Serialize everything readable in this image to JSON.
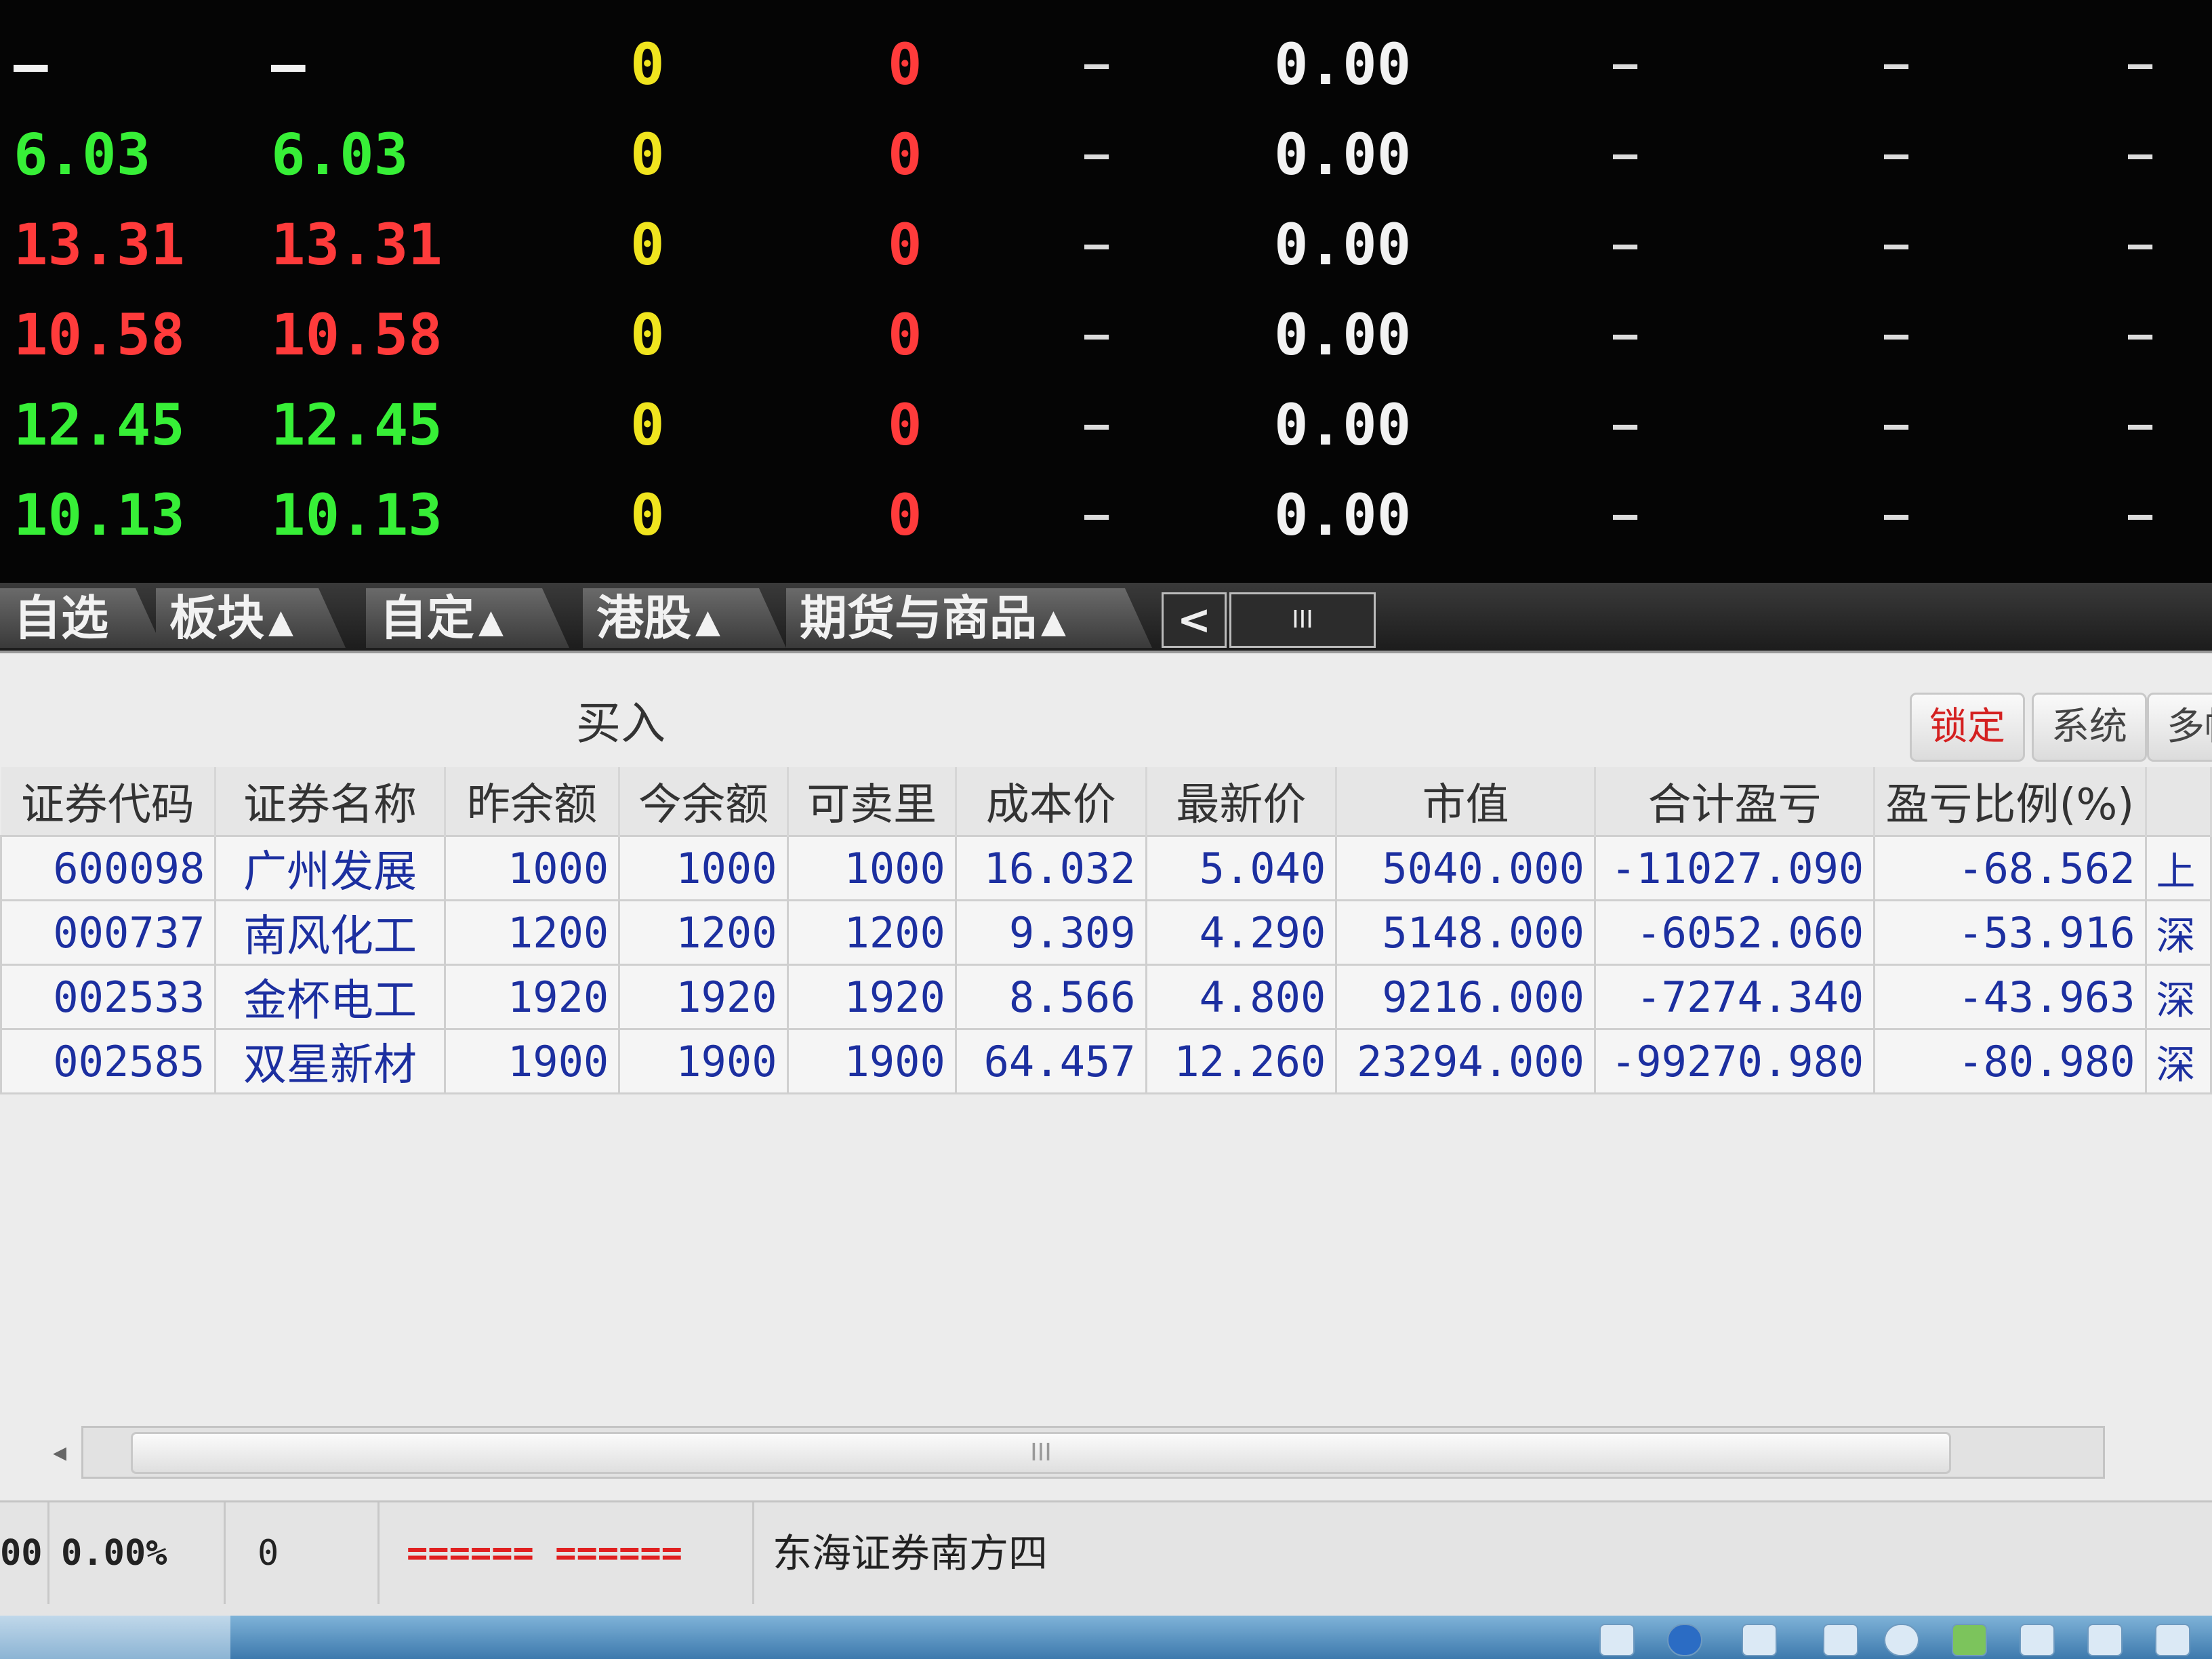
{
  "quote_rows": [
    {
      "c1": "—",
      "c2": "—",
      "c3": "0",
      "c4": "0",
      "c5": "—",
      "c6": "0.00",
      "c7": "—",
      "c8": "—",
      "c9": "—",
      "price_color": "#f2f2f2"
    },
    {
      "c1": "6.03",
      "c2": "6.03",
      "c3": "0",
      "c4": "0",
      "c5": "—",
      "c6": "0.00",
      "c7": "—",
      "c8": "—",
      "c9": "—",
      "price_color": "#37ef37"
    },
    {
      "c1": "13.31",
      "c2": "13.31",
      "c3": "0",
      "c4": "0",
      "c5": "—",
      "c6": "0.00",
      "c7": "—",
      "c8": "—",
      "c9": "—",
      "price_color": "#ff3b3b"
    },
    {
      "c1": "10.58",
      "c2": "10.58",
      "c3": "0",
      "c4": "0",
      "c5": "—",
      "c6": "0.00",
      "c7": "—",
      "c8": "—",
      "c9": "—",
      "price_color": "#ff3b3b"
    },
    {
      "c1": "12.45",
      "c2": "12.45",
      "c3": "0",
      "c4": "0",
      "c5": "—",
      "c6": "0.00",
      "c7": "—",
      "c8": "—",
      "c9": "—",
      "price_color": "#37ef37"
    },
    {
      "c1": "10.13",
      "c2": "10.13",
      "c3": "0",
      "c4": "0",
      "c5": "—",
      "c6": "0.00",
      "c7": "—",
      "c8": "—",
      "c9": "—",
      "price_color": "#37ef37"
    }
  ],
  "tabs": [
    {
      "label": "自选",
      "arrow": ""
    },
    {
      "label": "板块",
      "arrow": "▲"
    },
    {
      "label": "自定",
      "arrow": "▲"
    },
    {
      "label": "港股",
      "arrow": "▲"
    },
    {
      "label": "期货与商品",
      "arrow": "▲"
    }
  ],
  "tab_nav": {
    "left": "<",
    "scroll": "III"
  },
  "panel": {
    "title": "买入",
    "lock_label": "锁定",
    "system_label": "系统",
    "more_label": "多帐"
  },
  "holdings": {
    "columns": [
      "证券代码",
      "证券名称",
      "昨余额",
      "今余额",
      "可卖里",
      "成本价",
      "最新价",
      "市值",
      "合计盈亏",
      "盈亏比例(%)",
      ""
    ],
    "rows": [
      [
        "600098",
        "广州发展",
        "1000",
        "1000",
        "1000",
        "16.032",
        "5.040",
        "5040.000",
        "-11027.090",
        "-68.562",
        "上"
      ],
      [
        "000737",
        "南风化工",
        "1200",
        "1200",
        "1200",
        "9.309",
        "4.290",
        "5148.000",
        "-6052.060",
        "-53.916",
        "深"
      ],
      [
        "002533",
        "金杯电工",
        "1920",
        "1920",
        "1920",
        "8.566",
        "4.800",
        "9216.000",
        "-7274.340",
        "-43.963",
        "深"
      ],
      [
        "002585",
        "双星新材",
        "1900",
        "1900",
        "1900",
        "64.457",
        "12.260",
        "23294.000",
        "-99270.980",
        "-80.980",
        "深"
      ]
    ]
  },
  "scrollbar": {
    "left_arrow": "◂",
    "grip": "III"
  },
  "status": {
    "value1": "00",
    "percent": "0.00%",
    "value2": "0",
    "red_marks": "====== ======",
    "broker": "东海证券南方四"
  },
  "colors": {
    "up": "#ff3b3b",
    "down": "#37ef37",
    "neutral": "#f2f2f2",
    "table_text": "#1c2fa0"
  }
}
